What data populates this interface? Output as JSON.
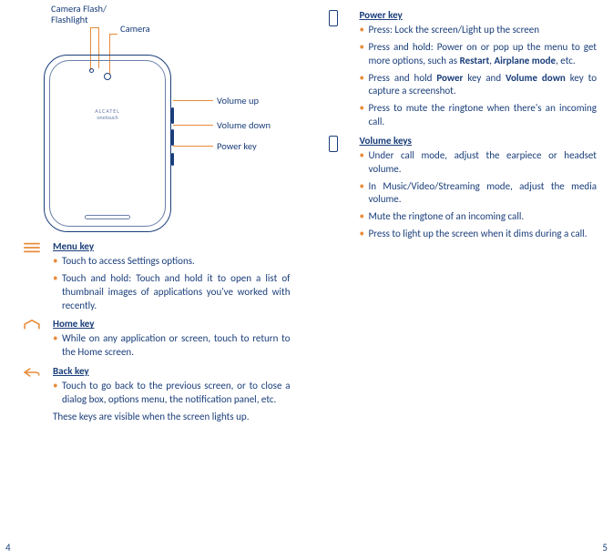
{
  "diagram": {
    "flash_label": "Camera Flash/\nFlashlight",
    "camera_label": "Camera",
    "volume_up_label": "Volume up",
    "volume_down_label": "Volume down",
    "power_key_label": "Power key",
    "brand1": "ALCATEL",
    "brand2": "onetouch"
  },
  "menu": {
    "title": "Menu key",
    "b1": "Touch to access Settings options.",
    "b2": "Touch and hold: Touch and hold it to open a list of thumbnail images of applications you've worked with recently."
  },
  "home": {
    "title": "Home key",
    "b1": "While on any application or screen, touch to return to the Home screen."
  },
  "back": {
    "title": "Back key",
    "b1": "Touch to go back to the previous screen, or to close a dialog box, options menu, the notification panel, etc.",
    "note": "These keys are visible when the screen lights up."
  },
  "power": {
    "title": "Power key",
    "b1": "Press: Lock the screen/Light up the screen",
    "b2_a": "Press and hold: Power on or pop up the menu to get more options, such as ",
    "b2_b": "Restart",
    "b2_c": ", ",
    "b2_d": "Airplane mode",
    "b2_e": ", etc.",
    "b3_a": "Press and hold ",
    "b3_b": "Power",
    "b3_c": " key and ",
    "b3_d": "Volume down",
    "b3_e": " key to capture a screenshot.",
    "b4": "Press to mute the ringtone when there's an incoming call."
  },
  "volume": {
    "title": "Volume keys",
    "b1": "Under call mode, adjust the earpiece or headset volume.",
    "b2": "In Music/Video/Streaming mode, adjust the media volume.",
    "b3": "Mute the ringtone of an incoming call.",
    "b4": "Press to light up the screen when it dims during a call."
  },
  "pages": {
    "left": "4",
    "right": "5"
  }
}
